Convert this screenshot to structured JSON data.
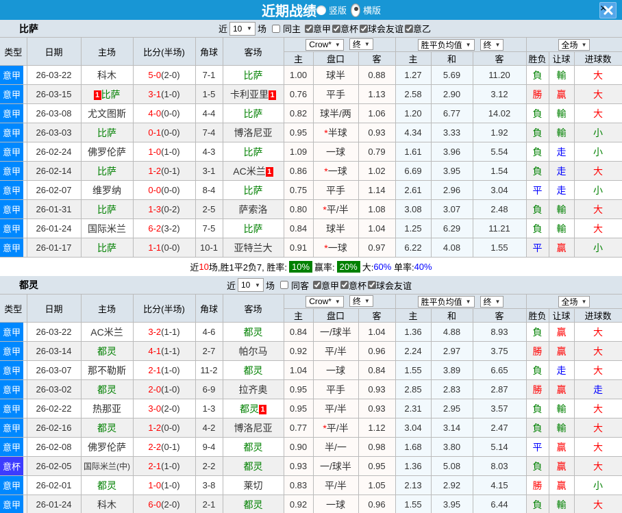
{
  "topbar": {
    "title": "近期战绩",
    "radios": [
      {
        "label": "竖版",
        "selected": false
      },
      {
        "label": "横版",
        "selected": true
      }
    ],
    "close_label": "×"
  },
  "league_colors": {
    "意甲": "#0088ff",
    "意杯": "#3c3cff"
  },
  "result_colors": {
    "負": "#008000",
    "勝": "#ff0000",
    "平": "#0000ff",
    "輸": "#008000",
    "贏": "#ff0000",
    "走": "#0000ff",
    "大": "#ff0000",
    "小": "#008000"
  },
  "accent": {
    "topbar": "#1896d5",
    "header_bg": "#dbe4ec",
    "border": "#bbbbbb",
    "team_green": "#008000",
    "score_red": "#ff0000"
  },
  "table_header": {
    "cols": [
      "类型",
      "日期",
      "主场",
      "比分(半场)",
      "角球",
      "客场"
    ],
    "groups": [
      {
        "select": "Crow*",
        "final": "终",
        "sub": [
          "主",
          "盘口",
          "客"
        ]
      },
      {
        "select": "胜平负均值",
        "final": "终",
        "sub": [
          "主",
          "和",
          "客"
        ]
      },
      {
        "select": "全场",
        "final": null,
        "sub": [
          "胜负",
          "让球",
          "进球数"
        ]
      }
    ]
  },
  "sections": [
    {
      "team": "比萨",
      "filter": {
        "near": "近",
        "count": "10",
        "unit": "场",
        "same": {
          "label": "同主",
          "checked": false
        },
        "leagues": [
          {
            "label": "意甲",
            "checked": true
          },
          {
            "label": "意杯",
            "checked": true
          },
          {
            "label": "球会友谊",
            "checked": true
          },
          {
            "label": "意乙",
            "checked": true
          }
        ]
      },
      "rows": [
        {
          "league": "意甲",
          "date": "26-03-22",
          "home": {
            "name": "科木"
          },
          "score": "5-0",
          "half": "(2-0)",
          "corners": "7-1",
          "away": {
            "name": "比萨",
            "green": true
          },
          "odds": [
            "1.00",
            "球半",
            "0.88"
          ],
          "avg": [
            "1.27",
            "5.69",
            "11.20"
          ],
          "result": [
            "負",
            "輸",
            "大"
          ]
        },
        {
          "league": "意甲",
          "date": "26-03-15",
          "home": {
            "name": "比萨",
            "green": true,
            "badge_before": "1"
          },
          "score": "3-1",
          "half": "(1-0)",
          "corners": "1-5",
          "away": {
            "name": "卡利亚里",
            "badge_after": "1"
          },
          "odds": [
            "0.76",
            "平手",
            "1.13"
          ],
          "avg": [
            "2.58",
            "2.90",
            "3.12"
          ],
          "result": [
            "勝",
            "贏",
            "大"
          ]
        },
        {
          "league": "意甲",
          "date": "26-03-08",
          "home": {
            "name": "尤文图斯"
          },
          "score": "4-0",
          "half": "(0-0)",
          "corners": "4-4",
          "away": {
            "name": "比萨",
            "green": true
          },
          "odds": [
            "0.82",
            "球半/两",
            "1.06"
          ],
          "avg": [
            "1.20",
            "6.77",
            "14.02"
          ],
          "result": [
            "負",
            "輸",
            "大"
          ]
        },
        {
          "league": "意甲",
          "date": "26-03-03",
          "home": {
            "name": "比萨",
            "green": true
          },
          "score": "0-1",
          "half": "(0-0)",
          "corners": "7-4",
          "away": {
            "name": "博洛尼亚"
          },
          "odds": [
            "0.95",
            "*半球",
            "0.93"
          ],
          "avg": [
            "4.34",
            "3.33",
            "1.92"
          ],
          "result": [
            "負",
            "輸",
            "小"
          ]
        },
        {
          "league": "意甲",
          "date": "26-02-24",
          "home": {
            "name": "佛罗伦萨"
          },
          "score": "1-0",
          "half": "(1-0)",
          "corners": "4-3",
          "away": {
            "name": "比萨",
            "green": true
          },
          "odds": [
            "1.09",
            "一球",
            "0.79"
          ],
          "avg": [
            "1.61",
            "3.96",
            "5.54"
          ],
          "result": [
            "負",
            "走",
            "小"
          ]
        },
        {
          "league": "意甲",
          "date": "26-02-14",
          "home": {
            "name": "比萨",
            "green": true
          },
          "score": "1-2",
          "half": "(0-1)",
          "corners": "3-1",
          "away": {
            "name": "AC米兰",
            "badge_after": "1"
          },
          "odds": [
            "0.86",
            "*一球",
            "1.02"
          ],
          "avg": [
            "6.69",
            "3.95",
            "1.54"
          ],
          "result": [
            "負",
            "走",
            "大"
          ]
        },
        {
          "league": "意甲",
          "date": "26-02-07",
          "home": {
            "name": "维罗纳"
          },
          "score": "0-0",
          "half": "(0-0)",
          "corners": "8-4",
          "away": {
            "name": "比萨",
            "green": true
          },
          "odds": [
            "0.75",
            "平手",
            "1.14"
          ],
          "avg": [
            "2.61",
            "2.96",
            "3.04"
          ],
          "result": [
            "平",
            "走",
            "小"
          ]
        },
        {
          "league": "意甲",
          "date": "26-01-31",
          "home": {
            "name": "比萨",
            "green": true
          },
          "score": "1-3",
          "half": "(0-2)",
          "corners": "2-5",
          "away": {
            "name": "萨索洛"
          },
          "odds": [
            "0.80",
            "*平/半",
            "1.08"
          ],
          "avg": [
            "3.08",
            "3.07",
            "2.48"
          ],
          "result": [
            "負",
            "輸",
            "大"
          ]
        },
        {
          "league": "意甲",
          "date": "26-01-24",
          "home": {
            "name": "国际米兰"
          },
          "score": "6-2",
          "half": "(3-2)",
          "corners": "7-5",
          "away": {
            "name": "比萨",
            "green": true
          },
          "odds": [
            "0.84",
            "球半",
            "1.04"
          ],
          "avg": [
            "1.25",
            "6.29",
            "11.21"
          ],
          "result": [
            "負",
            "輸",
            "大"
          ]
        },
        {
          "league": "意甲",
          "date": "26-01-17",
          "home": {
            "name": "比萨",
            "green": true
          },
          "score": "1-1",
          "half": "(0-0)",
          "corners": "10-1",
          "away": {
            "name": "亚特兰大"
          },
          "odds": [
            "0.91",
            "*一球",
            "0.97"
          ],
          "avg": [
            "6.22",
            "4.08",
            "1.55"
          ],
          "result": [
            "平",
            "贏",
            "小"
          ]
        }
      ],
      "summary": [
        {
          "text": "近"
        },
        {
          "text": "10",
          "color": "#ff0000"
        },
        {
          "text": "场,胜1平2负7, 胜率:"
        },
        {
          "text": "10%",
          "box": true
        },
        {
          "text": "赢率:"
        },
        {
          "text": "20%",
          "box": true
        },
        {
          "text": "大:"
        },
        {
          "text": "60%",
          "color": "#0000ff"
        },
        {
          "text": " 单率:"
        },
        {
          "text": "40%",
          "color": "#0000ff"
        }
      ]
    },
    {
      "team": "都灵",
      "filter": {
        "near": "近",
        "count": "10",
        "unit": "场",
        "same": {
          "label": "同客",
          "checked": false
        },
        "leagues": [
          {
            "label": "意甲",
            "checked": true
          },
          {
            "label": "意杯",
            "checked": true
          },
          {
            "label": "球会友谊",
            "checked": true
          }
        ]
      },
      "rows": [
        {
          "league": "意甲",
          "date": "26-03-22",
          "home": {
            "name": "AC米兰"
          },
          "score": "3-2",
          "half": "(1-1)",
          "corners": "4-6",
          "away": {
            "name": "都灵",
            "green": true
          },
          "odds": [
            "0.84",
            "一/球半",
            "1.04"
          ],
          "avg": [
            "1.36",
            "4.88",
            "8.93"
          ],
          "result": [
            "負",
            "贏",
            "大"
          ]
        },
        {
          "league": "意甲",
          "date": "26-03-14",
          "home": {
            "name": "都灵",
            "green": true
          },
          "score": "4-1",
          "half": "(1-1)",
          "corners": "2-7",
          "away": {
            "name": "帕尔马"
          },
          "odds": [
            "0.92",
            "平/半",
            "0.96"
          ],
          "avg": [
            "2.24",
            "2.97",
            "3.75"
          ],
          "result": [
            "勝",
            "贏",
            "大"
          ]
        },
        {
          "league": "意甲",
          "date": "26-03-07",
          "home": {
            "name": "那不勒斯"
          },
          "score": "2-1",
          "half": "(1-0)",
          "corners": "11-2",
          "away": {
            "name": "都灵",
            "green": true
          },
          "odds": [
            "1.04",
            "一球",
            "0.84"
          ],
          "avg": [
            "1.55",
            "3.89",
            "6.65"
          ],
          "result": [
            "負",
            "走",
            "大"
          ]
        },
        {
          "league": "意甲",
          "date": "26-03-02",
          "home": {
            "name": "都灵",
            "green": true
          },
          "score": "2-0",
          "half": "(1-0)",
          "corners": "6-9",
          "away": {
            "name": "拉齐奥"
          },
          "odds": [
            "0.95",
            "平手",
            "0.93"
          ],
          "avg": [
            "2.85",
            "2.83",
            "2.87"
          ],
          "result": [
            "勝",
            "贏",
            "走"
          ]
        },
        {
          "league": "意甲",
          "date": "26-02-22",
          "home": {
            "name": "热那亚"
          },
          "score": "3-0",
          "half": "(2-0)",
          "corners": "1-3",
          "away": {
            "name": "都灵",
            "green": true,
            "badge_after": "1"
          },
          "odds": [
            "0.95",
            "平/半",
            "0.93"
          ],
          "avg": [
            "2.31",
            "2.95",
            "3.57"
          ],
          "result": [
            "負",
            "輸",
            "大"
          ]
        },
        {
          "league": "意甲",
          "date": "26-02-16",
          "home": {
            "name": "都灵",
            "green": true
          },
          "score": "1-2",
          "half": "(0-0)",
          "corners": "4-2",
          "away": {
            "name": "博洛尼亚"
          },
          "odds": [
            "0.77",
            "*平/半",
            "1.12"
          ],
          "avg": [
            "3.04",
            "3.14",
            "2.47"
          ],
          "result": [
            "負",
            "輸",
            "大"
          ]
        },
        {
          "league": "意甲",
          "date": "26-02-08",
          "home": {
            "name": "佛罗伦萨"
          },
          "score": "2-2",
          "half": "(0-1)",
          "corners": "9-4",
          "away": {
            "name": "都灵",
            "green": true
          },
          "odds": [
            "0.90",
            "半/一",
            "0.98"
          ],
          "avg": [
            "1.68",
            "3.80",
            "5.14"
          ],
          "result": [
            "平",
            "贏",
            "大"
          ]
        },
        {
          "league": "意杯",
          "date": "26-02-05",
          "home": {
            "name": "国际米兰(中)"
          },
          "score": "2-1",
          "half": "(1-0)",
          "corners": "2-2",
          "away": {
            "name": "都灵",
            "green": true
          },
          "odds": [
            "0.93",
            "一/球半",
            "0.95"
          ],
          "avg": [
            "1.36",
            "5.08",
            "8.03"
          ],
          "result": [
            "負",
            "贏",
            "大"
          ]
        },
        {
          "league": "意甲",
          "date": "26-02-01",
          "home": {
            "name": "都灵",
            "green": true
          },
          "score": "1-0",
          "half": "(1-0)",
          "corners": "3-8",
          "away": {
            "name": "莱切"
          },
          "odds": [
            "0.83",
            "平/半",
            "1.05"
          ],
          "avg": [
            "2.13",
            "2.92",
            "4.15"
          ],
          "result": [
            "勝",
            "贏",
            "小"
          ]
        },
        {
          "league": "意甲",
          "date": "26-01-24",
          "home": {
            "name": "科木"
          },
          "score": "6-0",
          "half": "(2-0)",
          "corners": "2-1",
          "away": {
            "name": "都灵",
            "green": true
          },
          "odds": [
            "0.92",
            "一球",
            "0.96"
          ],
          "avg": [
            "1.55",
            "3.95",
            "6.44"
          ],
          "result": [
            "負",
            "輸",
            "大"
          ]
        }
      ],
      "summary": null
    }
  ]
}
